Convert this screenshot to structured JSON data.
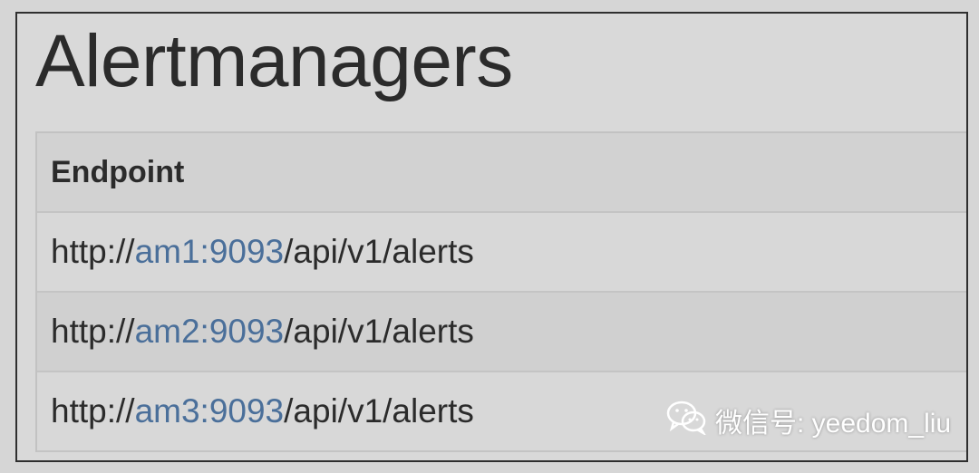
{
  "page": {
    "title": "Alertmanagers"
  },
  "table": {
    "header": "Endpoint",
    "rows": [
      {
        "prefix": "http://",
        "host": "am1:9093",
        "path": "/api/v1/alerts"
      },
      {
        "prefix": "http://",
        "host": "am2:9093",
        "path": "/api/v1/alerts"
      },
      {
        "prefix": "http://",
        "host": "am3:9093",
        "path": "/api/v1/alerts"
      }
    ]
  },
  "watermark": {
    "text": "微信号: yeedom_liu",
    "icon": "wechat-icon"
  },
  "colors": {
    "link": "#4a6f9a",
    "text": "#2b2b2b",
    "background": "#d9d9d9"
  }
}
